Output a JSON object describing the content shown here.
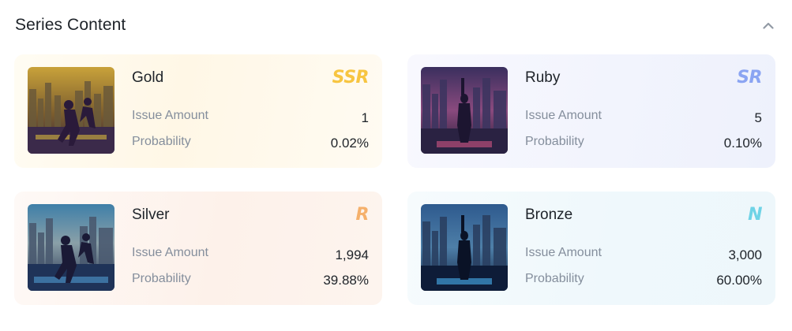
{
  "section": {
    "title": "Series Content"
  },
  "colors": {
    "ssr": "#f7c541",
    "sr": "#8aa4f2",
    "r": "#f5b06b",
    "n": "#6fd3e6"
  },
  "cards": [
    {
      "name": "Gold",
      "rarity": "SSR",
      "amount_label": "Issue Amount",
      "amount": "1",
      "probability_label": "Probability",
      "probability": "0.02%",
      "image": "dancers-city-gold-artwork"
    },
    {
      "name": "Ruby",
      "rarity": "SR",
      "amount_label": "Issue Amount",
      "amount": "5",
      "probability_label": "Probability",
      "probability": "0.10%",
      "image": "figure-city-ruby-artwork"
    },
    {
      "name": "Silver",
      "rarity": "R",
      "amount_label": "Issue Amount",
      "amount": "1,994",
      "probability_label": "Probability",
      "probability": "39.88%",
      "image": "dancers-city-silver-artwork"
    },
    {
      "name": "Bronze",
      "rarity": "N",
      "amount_label": "Issue Amount",
      "amount": "3,000",
      "probability_label": "Probability",
      "probability": "60.00%",
      "image": "figure-city-bronze-artwork"
    }
  ]
}
